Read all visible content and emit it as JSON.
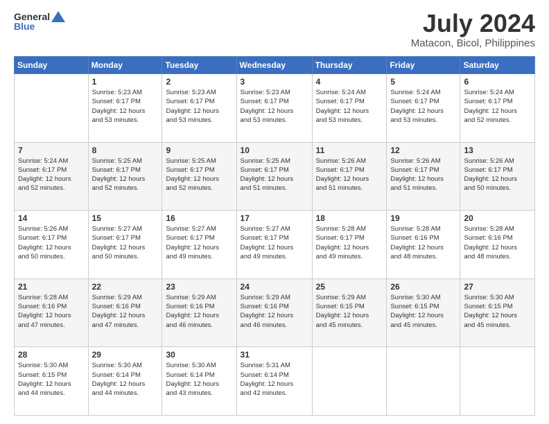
{
  "logo": {
    "line1": "General",
    "line2": "Blue"
  },
  "title": "July 2024",
  "subtitle": "Matacon, Bicol, Philippines",
  "days": [
    "Sunday",
    "Monday",
    "Tuesday",
    "Wednesday",
    "Thursday",
    "Friday",
    "Saturday"
  ],
  "weeks": [
    [
      {
        "date": "",
        "info": ""
      },
      {
        "date": "1",
        "info": "Sunrise: 5:23 AM\nSunset: 6:17 PM\nDaylight: 12 hours\nand 53 minutes."
      },
      {
        "date": "2",
        "info": "Sunrise: 5:23 AM\nSunset: 6:17 PM\nDaylight: 12 hours\nand 53 minutes."
      },
      {
        "date": "3",
        "info": "Sunrise: 5:23 AM\nSunset: 6:17 PM\nDaylight: 12 hours\nand 53 minutes."
      },
      {
        "date": "4",
        "info": "Sunrise: 5:24 AM\nSunset: 6:17 PM\nDaylight: 12 hours\nand 53 minutes."
      },
      {
        "date": "5",
        "info": "Sunrise: 5:24 AM\nSunset: 6:17 PM\nDaylight: 12 hours\nand 53 minutes."
      },
      {
        "date": "6",
        "info": "Sunrise: 5:24 AM\nSunset: 6:17 PM\nDaylight: 12 hours\nand 52 minutes."
      }
    ],
    [
      {
        "date": "7",
        "info": "Sunrise: 5:24 AM\nSunset: 6:17 PM\nDaylight: 12 hours\nand 52 minutes."
      },
      {
        "date": "8",
        "info": "Sunrise: 5:25 AM\nSunset: 6:17 PM\nDaylight: 12 hours\nand 52 minutes."
      },
      {
        "date": "9",
        "info": "Sunrise: 5:25 AM\nSunset: 6:17 PM\nDaylight: 12 hours\nand 52 minutes."
      },
      {
        "date": "10",
        "info": "Sunrise: 5:25 AM\nSunset: 6:17 PM\nDaylight: 12 hours\nand 51 minutes."
      },
      {
        "date": "11",
        "info": "Sunrise: 5:26 AM\nSunset: 6:17 PM\nDaylight: 12 hours\nand 51 minutes."
      },
      {
        "date": "12",
        "info": "Sunrise: 5:26 AM\nSunset: 6:17 PM\nDaylight: 12 hours\nand 51 minutes."
      },
      {
        "date": "13",
        "info": "Sunrise: 5:26 AM\nSunset: 6:17 PM\nDaylight: 12 hours\nand 50 minutes."
      }
    ],
    [
      {
        "date": "14",
        "info": "Sunrise: 5:26 AM\nSunset: 6:17 PM\nDaylight: 12 hours\nand 50 minutes."
      },
      {
        "date": "15",
        "info": "Sunrise: 5:27 AM\nSunset: 6:17 PM\nDaylight: 12 hours\nand 50 minutes."
      },
      {
        "date": "16",
        "info": "Sunrise: 5:27 AM\nSunset: 6:17 PM\nDaylight: 12 hours\nand 49 minutes."
      },
      {
        "date": "17",
        "info": "Sunrise: 5:27 AM\nSunset: 6:17 PM\nDaylight: 12 hours\nand 49 minutes."
      },
      {
        "date": "18",
        "info": "Sunrise: 5:28 AM\nSunset: 6:17 PM\nDaylight: 12 hours\nand 49 minutes."
      },
      {
        "date": "19",
        "info": "Sunrise: 5:28 AM\nSunset: 6:16 PM\nDaylight: 12 hours\nand 48 minutes."
      },
      {
        "date": "20",
        "info": "Sunrise: 5:28 AM\nSunset: 6:16 PM\nDaylight: 12 hours\nand 48 minutes."
      }
    ],
    [
      {
        "date": "21",
        "info": "Sunrise: 5:28 AM\nSunset: 6:16 PM\nDaylight: 12 hours\nand 47 minutes."
      },
      {
        "date": "22",
        "info": "Sunrise: 5:29 AM\nSunset: 6:16 PM\nDaylight: 12 hours\nand 47 minutes."
      },
      {
        "date": "23",
        "info": "Sunrise: 5:29 AM\nSunset: 6:16 PM\nDaylight: 12 hours\nand 46 minutes."
      },
      {
        "date": "24",
        "info": "Sunrise: 5:29 AM\nSunset: 6:16 PM\nDaylight: 12 hours\nand 46 minutes."
      },
      {
        "date": "25",
        "info": "Sunrise: 5:29 AM\nSunset: 6:15 PM\nDaylight: 12 hours\nand 45 minutes."
      },
      {
        "date": "26",
        "info": "Sunrise: 5:30 AM\nSunset: 6:15 PM\nDaylight: 12 hours\nand 45 minutes."
      },
      {
        "date": "27",
        "info": "Sunrise: 5:30 AM\nSunset: 6:15 PM\nDaylight: 12 hours\nand 45 minutes."
      }
    ],
    [
      {
        "date": "28",
        "info": "Sunrise: 5:30 AM\nSunset: 6:15 PM\nDaylight: 12 hours\nand 44 minutes."
      },
      {
        "date": "29",
        "info": "Sunrise: 5:30 AM\nSunset: 6:14 PM\nDaylight: 12 hours\nand 44 minutes."
      },
      {
        "date": "30",
        "info": "Sunrise: 5:30 AM\nSunset: 6:14 PM\nDaylight: 12 hours\nand 43 minutes."
      },
      {
        "date": "31",
        "info": "Sunrise: 5:31 AM\nSunset: 6:14 PM\nDaylight: 12 hours\nand 42 minutes."
      },
      {
        "date": "",
        "info": ""
      },
      {
        "date": "",
        "info": ""
      },
      {
        "date": "",
        "info": ""
      }
    ]
  ]
}
